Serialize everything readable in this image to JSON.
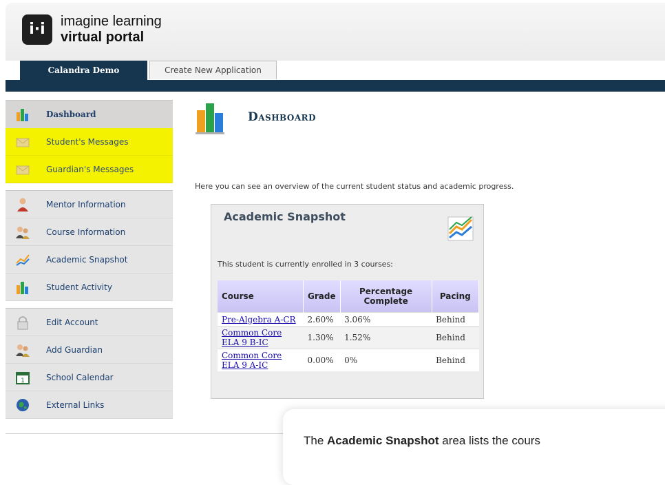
{
  "brand": {
    "logo_glyph": "i·i",
    "line1": "imagine learning",
    "line2": "virtual portal"
  },
  "tabs": [
    {
      "label": "Calandra Demo",
      "active": true
    },
    {
      "label": "Create New Application",
      "active": false
    }
  ],
  "sidebar": {
    "group1": [
      {
        "label": "Dashboard",
        "icon": "bar-chart-icon",
        "state": "active"
      },
      {
        "label": "Student's Messages",
        "icon": "envelope-icon",
        "state": "highlighted"
      },
      {
        "label": "Guardian's Messages",
        "icon": "envelope-icon",
        "state": "highlighted"
      }
    ],
    "group2": [
      {
        "label": "Mentor Information",
        "icon": "mentor-icon"
      },
      {
        "label": "Course Information",
        "icon": "people-icon"
      },
      {
        "label": "Academic Snapshot",
        "icon": "line-chart-icon"
      },
      {
        "label": "Student Activity",
        "icon": "bar-chart-icon"
      }
    ],
    "group3": [
      {
        "label": "Edit Account",
        "icon": "lock-icon"
      },
      {
        "label": "Add Guardian",
        "icon": "people-icon"
      },
      {
        "label": "School Calendar",
        "icon": "calendar-icon"
      },
      {
        "label": "External Links",
        "icon": "globe-icon"
      }
    ]
  },
  "main": {
    "title": "Dashboard",
    "overview": "Here you can see an overview of the current student status and academic progress.",
    "snapshot": {
      "title": "Academic Snapshot",
      "enrolled_text": "This student is currently enrolled in 3 courses:",
      "columns": [
        "Course",
        "Grade",
        "Percentage Complete",
        "Pacing"
      ],
      "rows": [
        {
          "course": "Pre-Algebra A-CR",
          "grade": "2.60%",
          "complete": "3.06%",
          "pacing": "Behind"
        },
        {
          "course": "Common Core ELA 9 B-IC",
          "grade": "1.30%",
          "complete": "1.52%",
          "pacing": "Behind"
        },
        {
          "course": "Common Core ELA 9 A-IC",
          "grade": "0.00%",
          "complete": "0%",
          "pacing": "Behind"
        }
      ]
    }
  },
  "popup": {
    "prefix": "The ",
    "bold": "Academic Snapshot",
    "suffix": " area lists the cours"
  },
  "colors": {
    "navy": "#16364f",
    "highlight": "#f5f200",
    "link": "#1a0dab"
  }
}
